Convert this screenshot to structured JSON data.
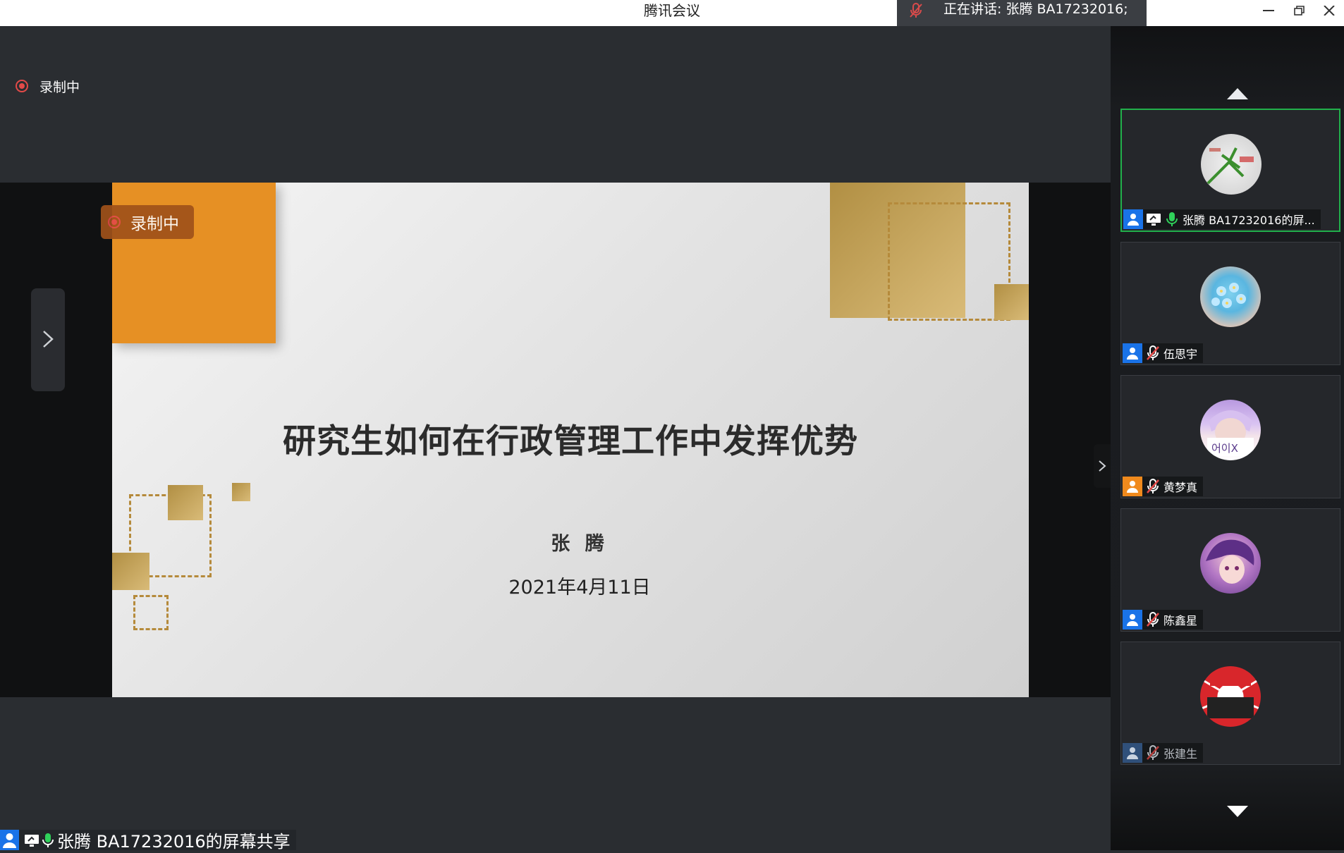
{
  "window": {
    "title": "腾讯会议",
    "speaking": "正在讲话: 张腾 BA17232016;"
  },
  "stage": {
    "recording_label": "录制中",
    "slide": {
      "recording_label": "录制中",
      "title": "研究生如何在行政管理工作中发挥优势",
      "author": "张 腾",
      "date": "2021年4月11日"
    },
    "sharer_label": "张腾 BA17232016的屏幕共享"
  },
  "participants": [
    {
      "name": "张腾 BA17232016的屏...",
      "badge": "blue",
      "mic": "on",
      "sharing": true,
      "active": true,
      "avatar": "mantis-avatar"
    },
    {
      "name": "伍思宇",
      "badge": "blue",
      "mic": "muted",
      "sharing": false,
      "active": false,
      "avatar": "flowers-avatar"
    },
    {
      "name": "黄梦真",
      "badge": "orange",
      "mic": "muted",
      "sharing": false,
      "active": false,
      "avatar": "portrait-avatar"
    },
    {
      "name": "陈鑫星",
      "badge": "blue",
      "mic": "muted",
      "sharing": false,
      "active": false,
      "avatar": "anime-avatar"
    },
    {
      "name": "张建生",
      "badge": "dim",
      "mic": "muted",
      "sharing": false,
      "active": false,
      "avatar": "emblem-avatar"
    }
  ],
  "colors": {
    "accent_green": "#21b04b",
    "brand_blue": "#1a73e8",
    "record_red": "#e34a48",
    "slide_orange": "#e69024"
  }
}
